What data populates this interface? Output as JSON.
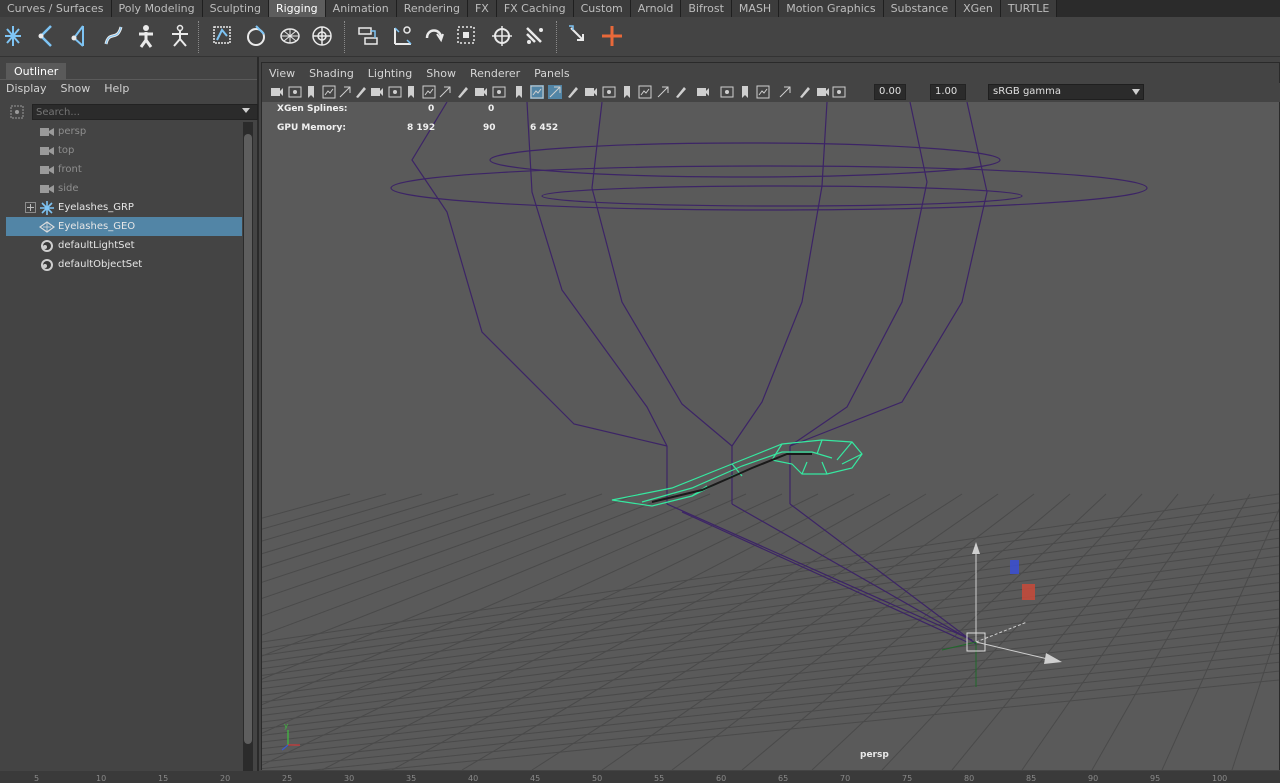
{
  "shelf_tabs": [
    "Curves / Surfaces",
    "Poly Modeling",
    "Sculpting",
    "Rigging",
    "Animation",
    "Rendering",
    "FX",
    "FX Caching",
    "Custom",
    "Arnold",
    "Bifrost",
    "MASH",
    "Motion Graphics",
    "Substance",
    "XGen",
    "TURTLE"
  ],
  "shelf_active_tab": "Rigging",
  "shelf_icons": [
    "create-joint-icon",
    "insert-joint-icon",
    "ik-handle-icon",
    "ik-spline-icon",
    "quick-rig-icon",
    "human-ik-icon",
    "bind-skin-icon",
    "paint-skin-weights-icon",
    "add-influence-icon",
    "lattice-icon",
    "cluster-icon",
    "point-constraint-icon",
    "aim-constraint-icon",
    "orient-constraint-icon",
    "scale-constraint-icon",
    "parent-constraint-icon",
    "pole-vector-icon",
    "locator-icon",
    "joint-orient-icon"
  ],
  "outliner": {
    "title": "Outliner",
    "menu": [
      "Display",
      "Show",
      "Help"
    ],
    "search_placeholder": "Search...",
    "items": [
      {
        "label": "persp",
        "icon": "camera-icon",
        "dim": true
      },
      {
        "label": "top",
        "icon": "camera-icon",
        "dim": true
      },
      {
        "label": "front",
        "icon": "camera-icon",
        "dim": true
      },
      {
        "label": "side",
        "icon": "camera-icon",
        "dim": true
      },
      {
        "label": "Eyelashes_GRP",
        "icon": "joint-icon",
        "expandable": true
      },
      {
        "label": "Eyelashes_GEO",
        "icon": "mesh-icon",
        "selected": true
      },
      {
        "label": "defaultLightSet",
        "icon": "set-icon"
      },
      {
        "label": "defaultObjectSet",
        "icon": "set-icon"
      }
    ]
  },
  "viewport": {
    "menu": [
      "View",
      "Shading",
      "Lighting",
      "Show",
      "Renderer",
      "Panels"
    ],
    "exposure": "0.00",
    "gamma": "1.00",
    "color_space": "sRGB gamma",
    "hud": [
      {
        "label": "XGen Splines:",
        "values": [
          "0",
          "0",
          ""
        ]
      },
      {
        "label": "GPU Memory:",
        "values": [
          "8 192",
          "90",
          "6 452"
        ]
      }
    ],
    "camera": "persp"
  },
  "time_slider": {
    "ticks": [
      "5",
      "10",
      "15",
      "20",
      "25",
      "30",
      "35",
      "40",
      "45",
      "50",
      "55",
      "60",
      "65",
      "70",
      "75",
      "80",
      "85",
      "90",
      "95",
      "100"
    ]
  }
}
